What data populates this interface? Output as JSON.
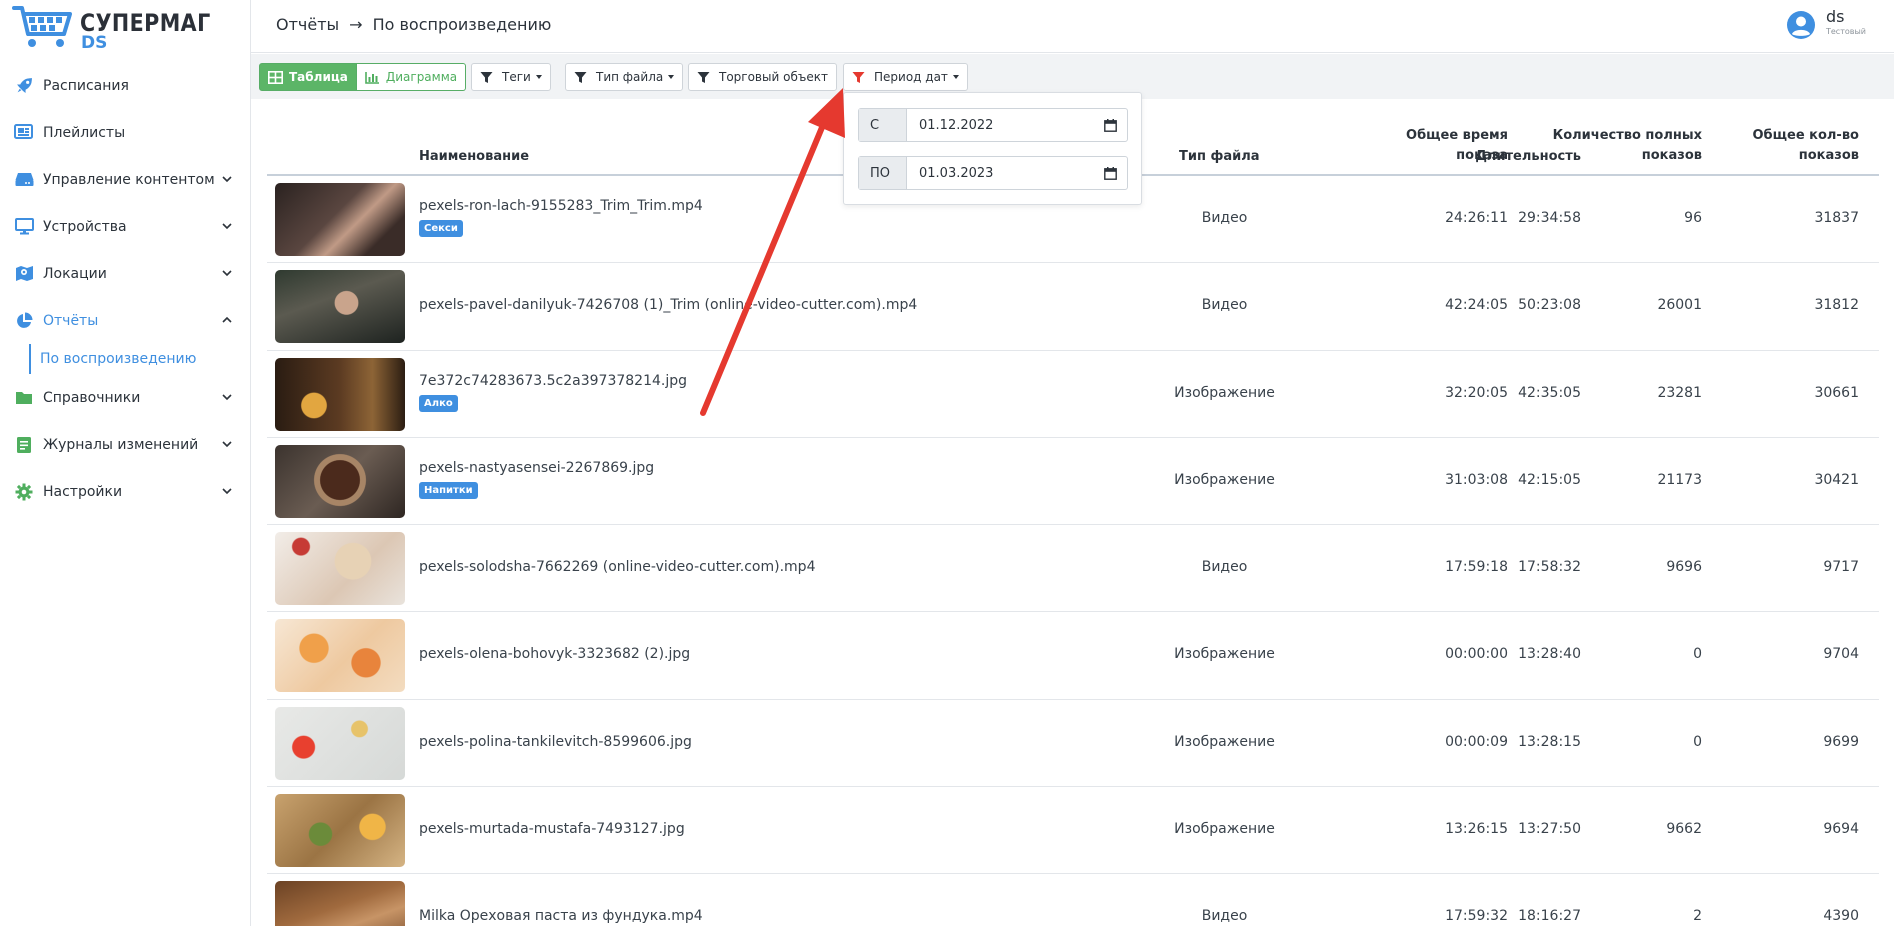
{
  "brand": {
    "name": "СУПЕРМАГ",
    "sub": "DS"
  },
  "sidebar": {
    "items": [
      {
        "label": "Расписания",
        "icon": "rocket-icon",
        "expandable": false
      },
      {
        "label": "Плейлисты",
        "icon": "playlist-icon",
        "expandable": false
      },
      {
        "label": "Управление контентом",
        "icon": "drive-icon",
        "expandable": true
      },
      {
        "label": "Устройства",
        "icon": "monitor-icon",
        "expandable": true
      },
      {
        "label": "Локации",
        "icon": "map-icon",
        "expandable": true
      },
      {
        "label": "Отчёты",
        "icon": "pie-chart-icon",
        "expandable": true,
        "active": true
      },
      {
        "label": "Справочники",
        "icon": "folder-icon",
        "expandable": true
      },
      {
        "label": "Журналы изменений",
        "icon": "journal-icon",
        "expandable": true
      },
      {
        "label": "Настройки",
        "icon": "gear-icon",
        "expandable": true
      }
    ],
    "sub_active": "По воспроизведению"
  },
  "header": {
    "breadcrumb": [
      "Отчёты",
      "По воспроизведению"
    ],
    "user": {
      "name": "ds",
      "role": "Тестовый"
    }
  },
  "toolbar": {
    "view_table": "Таблица",
    "view_chart": "Диаграмма",
    "filters": [
      "Теги",
      "Тип файла",
      "Торговый объект",
      "Период дат"
    ]
  },
  "date_filter": {
    "from_label": "С",
    "from_value": "01.12.2022",
    "to_label": "ПО",
    "to_value": "01.03.2023"
  },
  "table": {
    "headers": {
      "name": "Наименование",
      "type": "Тип файла",
      "duration": "Длительность",
      "total_time_1": "Общее время",
      "total_time_2": "показа",
      "full_1": "Количество полных",
      "full_2": "показов",
      "total_1": "Общее кол-во",
      "total_2": "показов"
    },
    "rows": [
      {
        "name": "pexels-ron-lach-9155283_Trim_Trim.mp4",
        "tag": "Секси",
        "type": "Видео",
        "duration": "29:34:58",
        "total_time": "24:26:11",
        "full": "96",
        "total": "31837",
        "thumb": "dark"
      },
      {
        "name": "pexels-pavel-danilyuk-7426708 (1)_Trim (online-video-cutter.com).mp4",
        "tag": "",
        "type": "Видео",
        "duration": "50:23:08",
        "total_time": "42:24:05",
        "full": "26001",
        "total": "31812",
        "thumb": "man"
      },
      {
        "name": "7e372c74283673.5c2a397378214.jpg",
        "tag": "Алко",
        "type": "Изображение",
        "duration": "42:35:05",
        "total_time": "32:20:05",
        "full": "23281",
        "total": "30661",
        "thumb": "whisky"
      },
      {
        "name": "pexels-nastyasensei-2267869.jpg",
        "tag": "Напитки",
        "type": "Изображение",
        "duration": "42:15:05",
        "total_time": "31:03:08",
        "full": "21173",
        "total": "30421",
        "thumb": "coffee"
      },
      {
        "name": "pexels-solodsha-7662269 (online-video-cutter.com).mp4",
        "tag": "",
        "type": "Видео",
        "duration": "17:58:32",
        "total_time": "17:59:18",
        "full": "9696",
        "total": "9717",
        "thumb": "toast"
      },
      {
        "name": "pexels-olena-bohovyk-3323682 (2).jpg",
        "tag": "",
        "type": "Изображение",
        "duration": "13:28:40",
        "total_time": "00:00:00",
        "full": "0",
        "total": "9704",
        "thumb": "citrus"
      },
      {
        "name": "pexels-polina-tankilevitch-8599606.jpg",
        "tag": "",
        "type": "Изображение",
        "duration": "13:28:15",
        "total_time": "00:00:09",
        "full": "0",
        "total": "9699",
        "thumb": "light"
      },
      {
        "name": "pexels-murtada-mustafa-7493127.jpg",
        "tag": "",
        "type": "Изображение",
        "duration": "13:27:50",
        "total_time": "13:26:15",
        "full": "9662",
        "total": "9694",
        "thumb": "fruit"
      },
      {
        "name": "Milka Ореховая паста из фундука.mp4",
        "tag": "",
        "type": "Видео",
        "duration": "18:16:27",
        "total_time": "17:59:32",
        "full": "2",
        "total": "4390",
        "thumb": "choco"
      }
    ]
  },
  "colors": {
    "accent": "#3f8fe0",
    "green": "#5cb567",
    "annotation": "#e5392f"
  }
}
